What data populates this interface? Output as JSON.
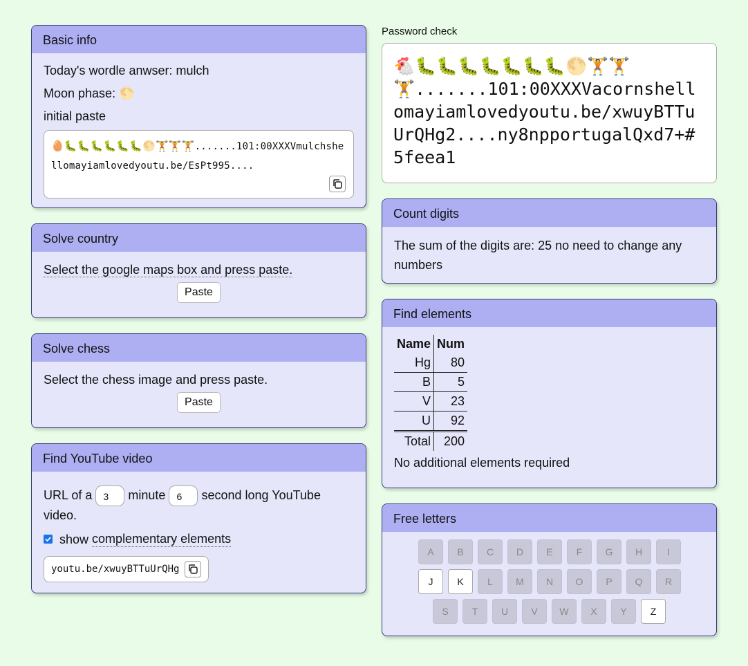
{
  "basic_info": {
    "title": "Basic info",
    "wordle_line": "Today's wordle anwser: mulch",
    "moon_label": "Moon phase:",
    "moon_icon": "🌕",
    "initial_paste_label": "initial paste",
    "initial_paste_emoji": "🥚🐛🐛🐛🐛🐛🐛🌕🏋️🏋️🏋️",
    "initial_paste_text": ".......101:00XXXVmulchshellomayiamlovedyoutu.be/EsPt995...."
  },
  "solve_country": {
    "title": "Solve country",
    "instruction": "Select the google maps box and press paste.",
    "button": "Paste"
  },
  "solve_chess": {
    "title": "Solve chess",
    "instruction": "Select the chess image and press paste.",
    "button": "Paste"
  },
  "youtube": {
    "title": "Find YouTube video",
    "text_a": "URL of a",
    "minutes": "3",
    "text_b": "minute",
    "seconds": "6",
    "text_c": "second long YouTube video.",
    "checkbox_prefix": "show",
    "checkbox_label": "complementary elements",
    "url": "youtu.be/xwuyBTTuUrQHg"
  },
  "password": {
    "label": "Password check",
    "emoji": "🐔🐛🐛🐛🐛🐛🐛🐛🌕🏋️🏋️🏋️",
    "text": ".......101:00XXXVacornshellomayiamlovedyoutu.be/xwuyBTTuUrQHg2....ny8npportugalQxd7+#5feea1"
  },
  "count_digits": {
    "title": "Count digits",
    "text": "The sum of the digits are: 25 no need to change any numbers"
  },
  "find_elements": {
    "title": "Find elements",
    "headers": [
      "Name",
      "Num"
    ],
    "rows": [
      [
        "Hg",
        "80"
      ],
      [
        "B",
        "5"
      ],
      [
        "V",
        "23"
      ],
      [
        "U",
        "92"
      ]
    ],
    "total_label": "Total",
    "total_value": "200",
    "note": "No additional elements required"
  },
  "free_letters": {
    "title": "Free letters",
    "row1": [
      "A",
      "B",
      "C",
      "D",
      "E",
      "F",
      "G",
      "H",
      "I"
    ],
    "row2": [
      "J",
      "K",
      "L",
      "M",
      "N",
      "O",
      "P",
      "Q",
      "R"
    ],
    "row3": [
      "S",
      "T",
      "U",
      "V",
      "W",
      "X",
      "Y",
      "Z"
    ],
    "free": [
      "J",
      "K",
      "Z"
    ]
  }
}
